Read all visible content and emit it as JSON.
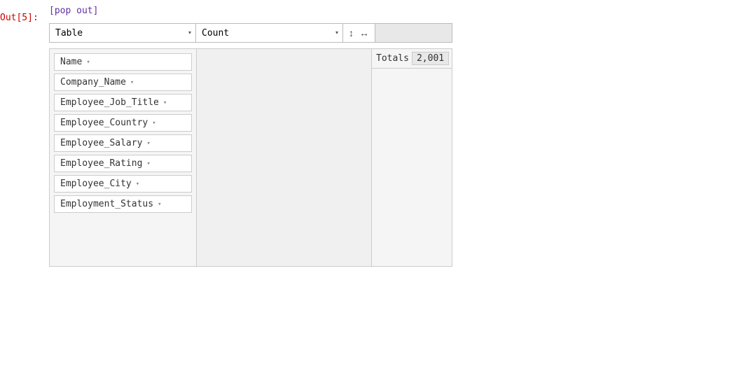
{
  "output_label": "Out[5]:",
  "pop_out_link": "[pop out]",
  "toolbar": {
    "table_select_value": "Table",
    "count_select_value": "Count",
    "table_options": [
      "Table"
    ],
    "count_options": [
      "Count"
    ]
  },
  "fields": [
    {
      "label": "Name",
      "arrow": "▾"
    },
    {
      "label": "Company_Name",
      "arrow": "▾"
    },
    {
      "label": "Employee_Job_Title",
      "arrow": "▾"
    },
    {
      "label": "Employee_Country",
      "arrow": "▾"
    },
    {
      "label": "Employee_Salary",
      "arrow": "▾"
    },
    {
      "label": "Employee_Rating",
      "arrow": "▾"
    },
    {
      "label": "Employee_City",
      "arrow": "▾"
    },
    {
      "label": "Employment_Status",
      "arrow": "▾"
    }
  ],
  "totals": {
    "label": "Totals",
    "value": "2,001"
  },
  "sort_icons": {
    "up_down": "↕",
    "left_right": "↔"
  }
}
